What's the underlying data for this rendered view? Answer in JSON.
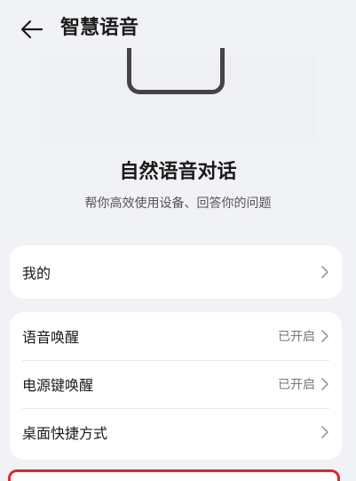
{
  "header": {
    "title": "智慧语音",
    "back_icon": "arrow-left-icon"
  },
  "feature": {
    "title": "自然语音对话",
    "subtitle": "帮你高效使用设备、回答你的问题"
  },
  "mine": {
    "label": "我的"
  },
  "settings": {
    "items": [
      {
        "label": "语音唤醒",
        "status": "已开启"
      },
      {
        "label": "电源键唤醒",
        "status": "已开启"
      },
      {
        "label": "桌面快捷方式",
        "status": ""
      }
    ]
  },
  "colors": {
    "background": "#f1f2f5",
    "card": "#ffffff",
    "highlight": "#e0262b"
  }
}
